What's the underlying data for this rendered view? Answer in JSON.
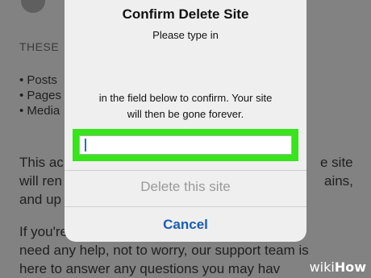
{
  "background": {
    "heading": "THESE",
    "bullets": [
      "• Posts",
      "• Pages",
      "• Media"
    ],
    "paragraph1_left": [
      "This ac",
      "will ren",
      "and up"
    ],
    "paragraph1_right": [
      "e site",
      "ains,",
      ""
    ],
    "paragraph2_lines": [
      "If you're                                               or",
      "need any help, not to worry, our support team is",
      "here to answer any questions you may hav"
    ]
  },
  "dialog": {
    "title": "Confirm Delete Site",
    "subtitle": "Please type in",
    "body_line1": "in the field below to confirm. Your site",
    "body_line2": "will then be gone forever.",
    "input_value": "",
    "delete_label": "Delete this site",
    "cancel_label": "Cancel"
  },
  "colors": {
    "highlight": "#36e51a",
    "cancel": "#1a5db0",
    "disabled": "#9a9a9a",
    "dialog_bg": "#efefef"
  },
  "watermark": {
    "part1": "wiki",
    "part2": "How"
  }
}
